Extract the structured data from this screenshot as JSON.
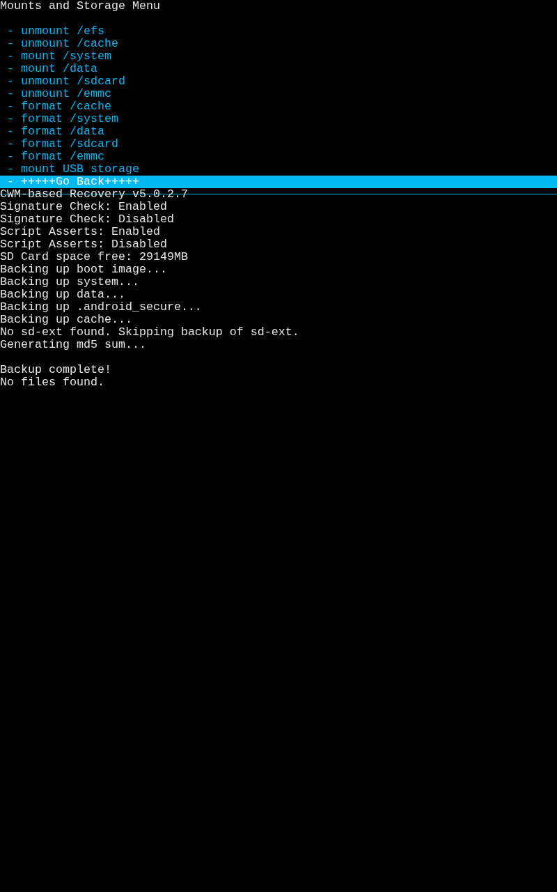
{
  "menu": {
    "title": "Mounts and Storage Menu",
    "items": [
      {
        "label": "- unmount /efs",
        "selected": false
      },
      {
        "label": "- unmount /cache",
        "selected": false
      },
      {
        "label": "- mount /system",
        "selected": false
      },
      {
        "label": "- mount /data",
        "selected": false
      },
      {
        "label": "- unmount /sdcard",
        "selected": false
      },
      {
        "label": "- unmount /emmc",
        "selected": false
      },
      {
        "label": "- format /cache",
        "selected": false
      },
      {
        "label": "- format /system",
        "selected": false
      },
      {
        "label": "- format /data",
        "selected": false
      },
      {
        "label": "- format /sdcard",
        "selected": false
      },
      {
        "label": "- format /emmc",
        "selected": false
      },
      {
        "label": "- mount USB storage",
        "selected": false
      },
      {
        "label": "- +++++Go Back+++++",
        "selected": true
      }
    ]
  },
  "log": [
    {
      "lines": [
        "CWM-based Recovery v5.0.2.7",
        "Signature Check: Enabled",
        "Signature Check: Disabled",
        "Script Asserts: Enabled",
        "Script Asserts: Disabled",
        "SD Card space free: 29149MB",
        "Backing up boot image...",
        "Backing up system...",
        "Backing up data...",
        "Backing up .android_secure...",
        "Backing up cache...",
        "No sd-ext found. Skipping backup of sd-ext.",
        "Generating md5 sum..."
      ]
    },
    {
      "lines": [
        "Backup complete!",
        "No files found."
      ]
    }
  ]
}
